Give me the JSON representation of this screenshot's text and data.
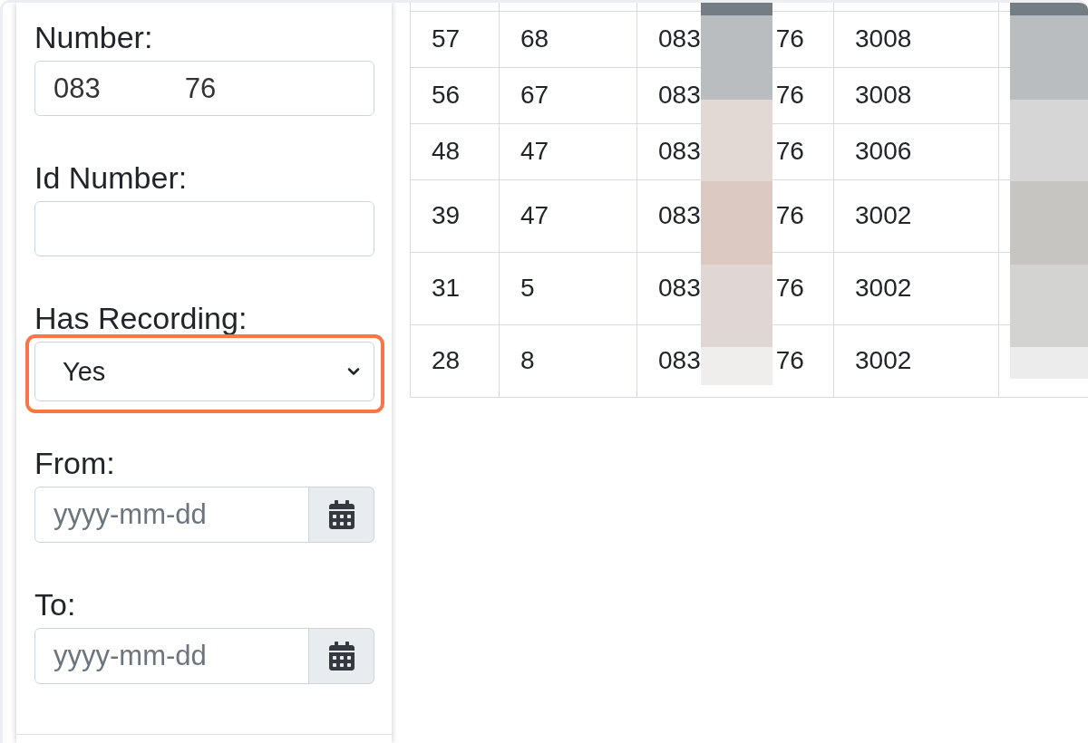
{
  "filters": [
    {
      "kind": "text",
      "label": "Number:",
      "value_parts": [
        "083",
        "76"
      ],
      "highlighted": false
    },
    {
      "kind": "text",
      "label": "Id Number:",
      "highlighted": false
    },
    {
      "kind": "select",
      "label": "Has Recording:",
      "value": "Yes",
      "highlighted": true
    },
    {
      "kind": "date",
      "label": "From:",
      "placeholder": "yyyy-mm-dd",
      "highlighted": false
    },
    {
      "kind": "date",
      "label": "To:",
      "placeholder": "yyyy-mm-dd",
      "highlighted": false
    }
  ],
  "table": {
    "rows": [
      {
        "cells": [
          "57",
          "68",
          [
            "083",
            "76"
          ],
          "3008"
        ]
      },
      {
        "cells": [
          "56",
          "67",
          [
            "083",
            "76"
          ],
          "3008"
        ]
      },
      {
        "cells": [
          "48",
          "47",
          [
            "083",
            "76"
          ],
          "3006"
        ]
      },
      {
        "cells": [
          "39",
          "47",
          [
            "083",
            "76"
          ],
          "3002"
        ]
      },
      {
        "cells": [
          "31",
          "5",
          [
            "083",
            "76"
          ],
          "3002"
        ]
      },
      {
        "cells": [
          "28",
          "8",
          [
            "083",
            "76"
          ],
          "3002"
        ]
      }
    ]
  }
}
